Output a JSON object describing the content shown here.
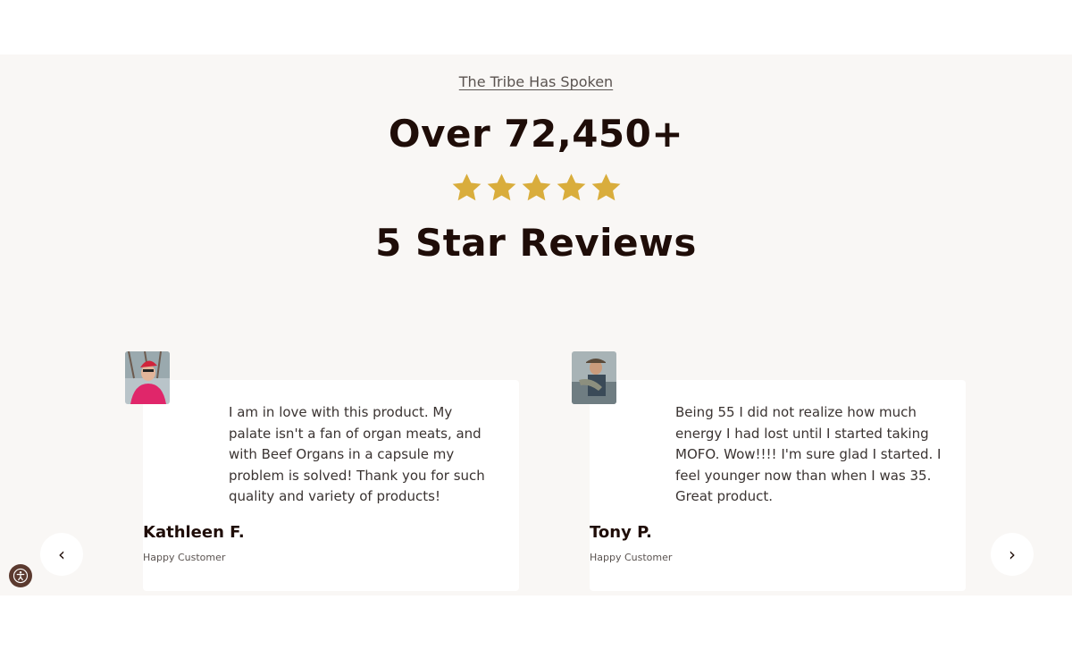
{
  "section": {
    "eyebrow": "The Tribe Has Spoken",
    "headline_top": "Over 72,450+",
    "rating": {
      "stars": 5,
      "max": 5,
      "color": "#d9ad3c"
    },
    "headline_bottom": "5 Star Reviews"
  },
  "reviews": [
    {
      "quote": "I am in love with this product. My palate isn't a fan of organ meats, and with Beef Organs in a capsule my problem is solved! Thank you for such quality and variety of products!",
      "author": "Kathleen F.",
      "role": "Happy Customer",
      "avatar": "customer-photo-kathleen"
    },
    {
      "quote": "Being 55 I did not realize how much energy I had lost until I started taking MOFO. Wow!!!! I'm sure glad I started. I feel younger now than when I was 35. Great product.",
      "author": "Tony P.",
      "role": "Happy Customer",
      "avatar": "customer-photo-tony"
    }
  ],
  "carousel": {
    "prev_label": "‹",
    "next_label": "›"
  },
  "icons": {
    "star": "star-icon",
    "accessibility": "accessibility-icon"
  }
}
